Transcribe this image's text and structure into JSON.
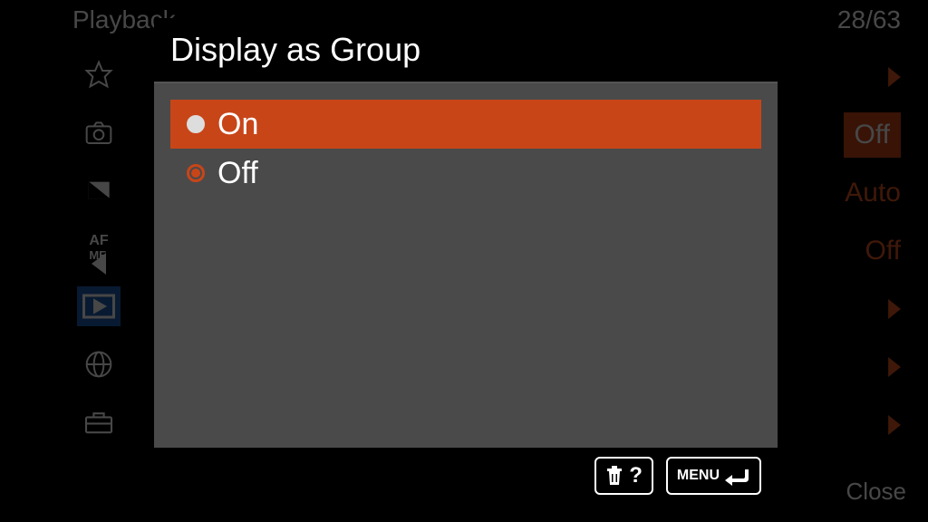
{
  "background": {
    "breadcrumb": "Playback",
    "page_counter": "28/63",
    "close_label": "Close",
    "right_values": {
      "off1": "Off",
      "auto": "Auto",
      "off2": "Off"
    }
  },
  "modal": {
    "title": "Display as Group",
    "options": [
      {
        "label": "On",
        "selected": true,
        "current": false
      },
      {
        "label": "Off",
        "selected": false,
        "current": true
      }
    ],
    "footer": {
      "help_symbol": "?",
      "menu_label": "MENU"
    }
  }
}
